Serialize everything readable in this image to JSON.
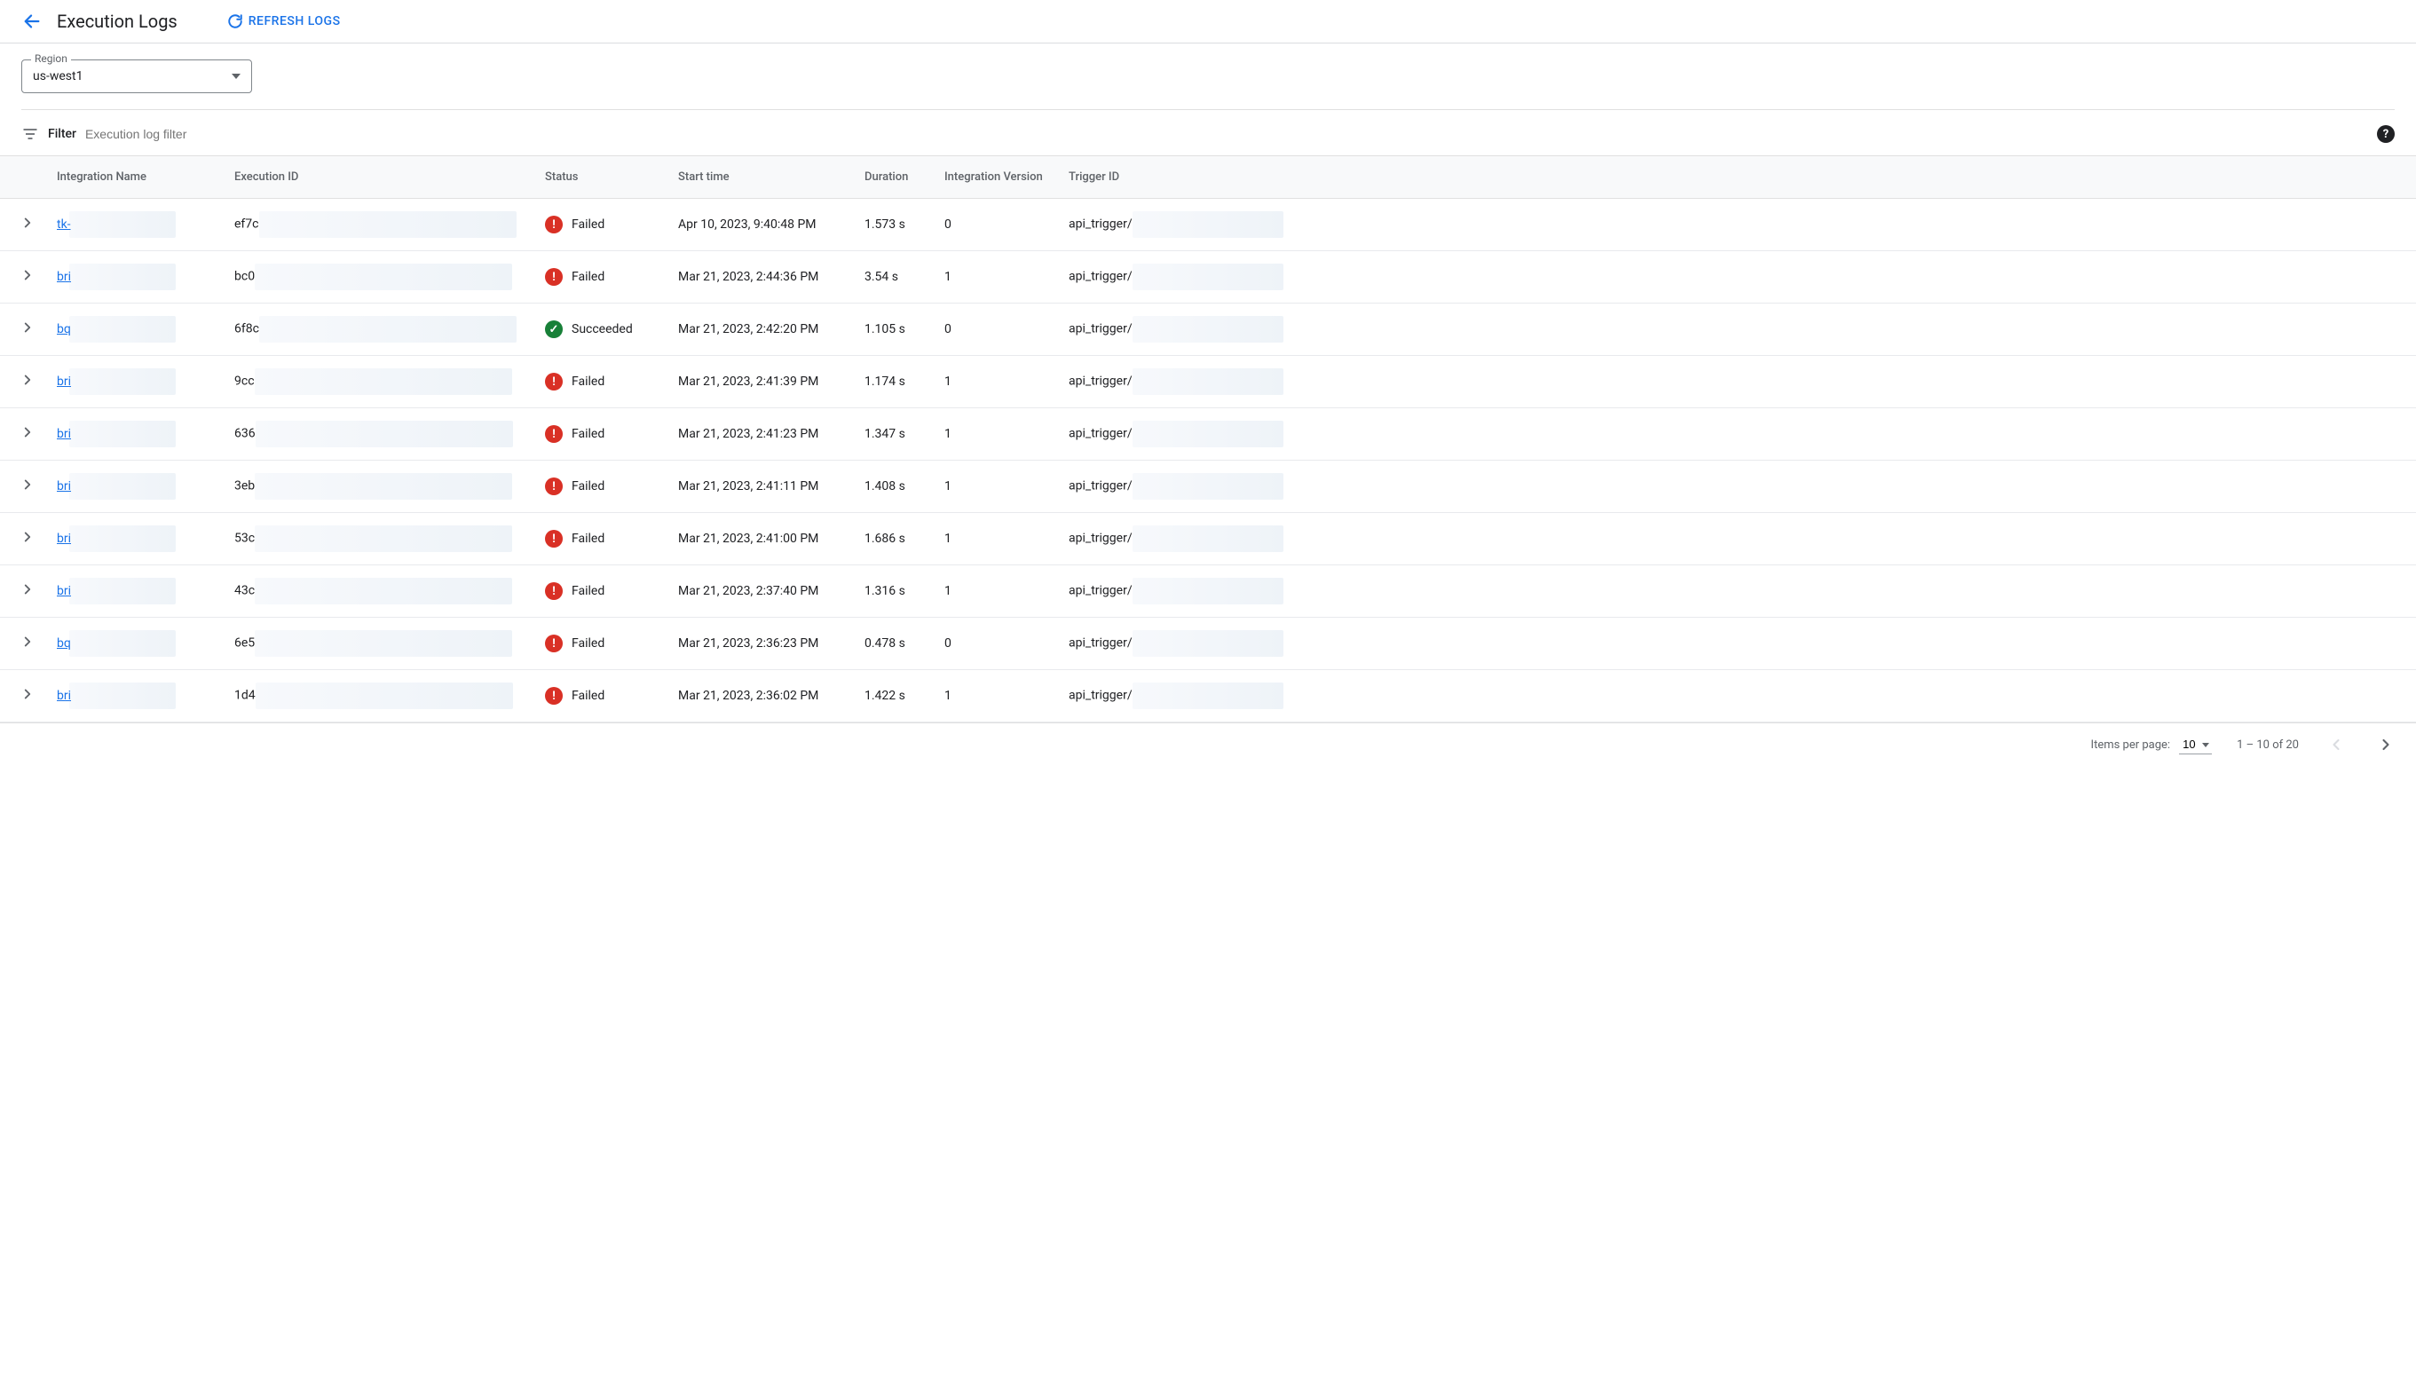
{
  "header": {
    "title": "Execution Logs",
    "refresh_label": "Refresh Logs"
  },
  "region": {
    "label": "Region",
    "value": "us-west1"
  },
  "filter": {
    "label": "Filter",
    "placeholder": "Execution log filter"
  },
  "columns": {
    "integration_name": "Integration Name",
    "execution_id": "Execution ID",
    "status": "Status",
    "start_time": "Start time",
    "duration": "Duration",
    "integration_version": "Integration Version",
    "trigger_id": "Trigger ID"
  },
  "status_labels": {
    "failed": "Failed",
    "succeeded": "Succeeded"
  },
  "rows": [
    {
      "name_prefix": "tk-",
      "exec_prefix": "ef7c",
      "status": "failed",
      "start": "Apr 10, 2023, 9:40:48 PM",
      "duration": "1.573 s",
      "version": "0",
      "trigger_prefix": "api_trigger/"
    },
    {
      "name_prefix": "bri",
      "exec_prefix": "bc0",
      "status": "failed",
      "start": "Mar 21, 2023, 2:44:36 PM",
      "duration": "3.54 s",
      "version": "1",
      "trigger_prefix": "api_trigger/"
    },
    {
      "name_prefix": "bq",
      "exec_prefix": "6f8c",
      "status": "succeeded",
      "start": "Mar 21, 2023, 2:42:20 PM",
      "duration": "1.105 s",
      "version": "0",
      "trigger_prefix": "api_trigger/"
    },
    {
      "name_prefix": "bri",
      "exec_prefix": "9cc",
      "status": "failed",
      "start": "Mar 21, 2023, 2:41:39 PM",
      "duration": "1.174 s",
      "version": "1",
      "trigger_prefix": "api_trigger/"
    },
    {
      "name_prefix": "bri",
      "exec_prefix": "636",
      "status": "failed",
      "start": "Mar 21, 2023, 2:41:23 PM",
      "duration": "1.347 s",
      "version": "1",
      "trigger_prefix": "api_trigger/"
    },
    {
      "name_prefix": "bri",
      "exec_prefix": "3eb",
      "status": "failed",
      "start": "Mar 21, 2023, 2:41:11 PM",
      "duration": "1.408 s",
      "version": "1",
      "trigger_prefix": "api_trigger/"
    },
    {
      "name_prefix": "bri",
      "exec_prefix": "53c",
      "status": "failed",
      "start": "Mar 21, 2023, 2:41:00 PM",
      "duration": "1.686 s",
      "version": "1",
      "trigger_prefix": "api_trigger/"
    },
    {
      "name_prefix": "bri",
      "exec_prefix": "43c",
      "status": "failed",
      "start": "Mar 21, 2023, 2:37:40 PM",
      "duration": "1.316 s",
      "version": "1",
      "trigger_prefix": "api_trigger/"
    },
    {
      "name_prefix": "bq",
      "exec_prefix": "6e5",
      "status": "failed",
      "start": "Mar 21, 2023, 2:36:23 PM",
      "duration": "0.478 s",
      "version": "0",
      "trigger_prefix": "api_trigger/"
    },
    {
      "name_prefix": "bri",
      "exec_prefix": "1d4",
      "status": "failed",
      "start": "Mar 21, 2023, 2:36:02 PM",
      "duration": "1.422 s",
      "version": "1",
      "trigger_prefix": "api_trigger/"
    }
  ],
  "paginator": {
    "items_per_page_label": "Items per page:",
    "items_per_page": "10",
    "range_label": "1 – 10 of 20"
  }
}
